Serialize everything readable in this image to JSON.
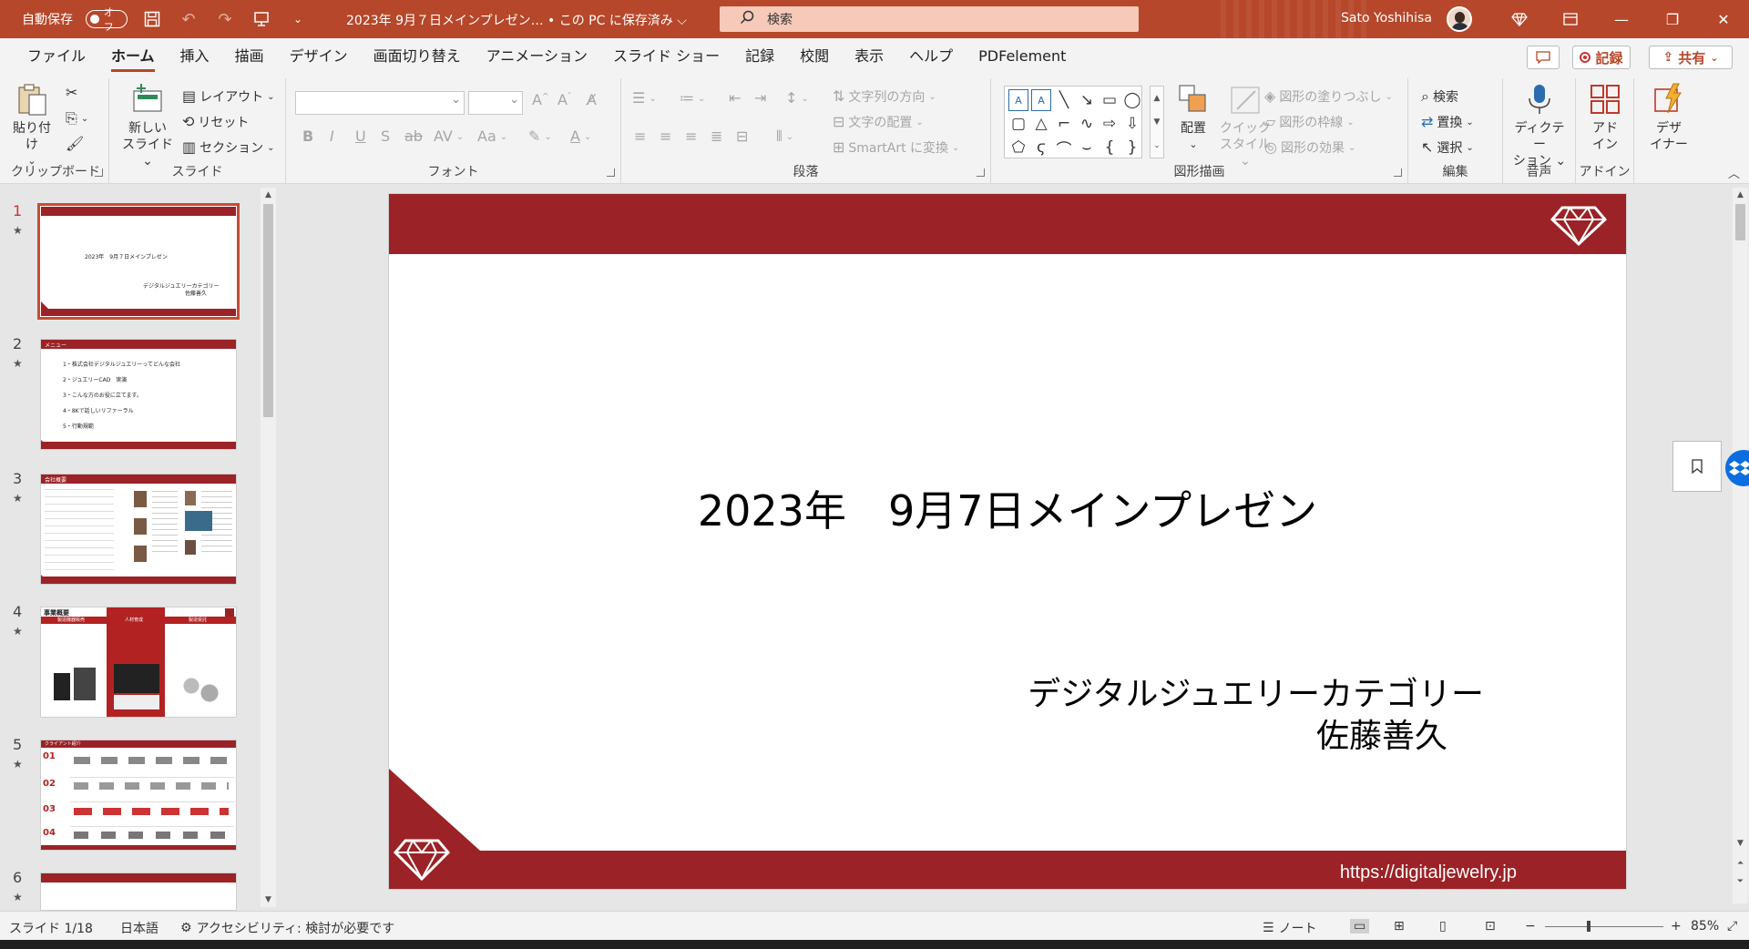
{
  "titlebar": {
    "autosave_label": "自動保存",
    "autosave_state": "オフ",
    "document_title": "2023年 9月７日メインプレゼン…  •  この PC に保存済み ⌵",
    "search_placeholder": "検索",
    "user_name": "Sato Yoshihisa"
  },
  "menu": {
    "tabs": [
      "ファイル",
      "ホーム",
      "挿入",
      "描画",
      "デザイン",
      "画面切り替え",
      "アニメーション",
      "スライド ショー",
      "記録",
      "校閲",
      "表示",
      "ヘルプ",
      "PDFelement"
    ],
    "record_button": "記録",
    "share_button": "共有"
  },
  "ribbon": {
    "clipboard": {
      "label": "クリップボード",
      "paste": "貼り付け"
    },
    "slides": {
      "label": "スライド",
      "new_slide": "新しい",
      "new_slide2": "スライド",
      "layout": "レイアウト",
      "reset": "リセット",
      "section": "セクション"
    },
    "font": {
      "label": "フォント"
    },
    "paragraph": {
      "label": "段落",
      "text_direction": "文字列の方向",
      "align_text": "文字の配置",
      "smartart": "SmartArt に変換"
    },
    "drawing": {
      "label": "図形描画",
      "arrange": "配置",
      "quick_styles1": "クイック",
      "quick_styles2": "スタイル",
      "shape_fill": "図形の塗りつぶし",
      "shape_outline": "図形の枠線",
      "shape_effects": "図形の効果"
    },
    "editing": {
      "label": "編集",
      "find": "検索",
      "replace": "置換",
      "select": "選択"
    },
    "voice": {
      "label": "音声",
      "dictate1": "ディクテー",
      "dictate2": "ション"
    },
    "addins": {
      "label": "アドイン",
      "addin1": "アド",
      "addin2": "イン"
    },
    "designer": {
      "label1": "デザ",
      "label2": "イナー"
    }
  },
  "thumbnails": [
    {
      "num": "1",
      "title": "2023年　9月７日メインプレゼン",
      "sub1": "デジタルジュエリーカテゴリー",
      "sub2": "佐藤善久"
    },
    {
      "num": "2",
      "header": "メニュー",
      "items": [
        "1・株式会社デジタルジュエリーってどんな会社",
        "2・ジュエリーCAD　実演",
        "3・こんな方のお役に立てます。",
        "4・8Kで話しいリファーラル",
        "5・行動規範"
      ]
    },
    {
      "num": "3",
      "header": "会社概要"
    },
    {
      "num": "4",
      "header": "事業概要",
      "cols": [
        "製造機器販売",
        "人材育成",
        "製造受託"
      ]
    },
    {
      "num": "5",
      "header": "クライアント紹介",
      "rows": [
        "01",
        "02",
        "03",
        "04"
      ]
    },
    {
      "num": "6"
    }
  ],
  "slide": {
    "title": "2023年　9月7日メインプレゼン",
    "subtitle1": "デジタルジュエリーカテゴリー",
    "subtitle2": "佐藤善久",
    "url": "https://digitaljewelry.jp",
    "brand_color": "#9b2226"
  },
  "status": {
    "slide_info": "スライド 1/18",
    "language": "日本語",
    "accessibility": "アクセシビリティ: 検討が必要です",
    "notes": "ノート",
    "zoom": "85%"
  }
}
